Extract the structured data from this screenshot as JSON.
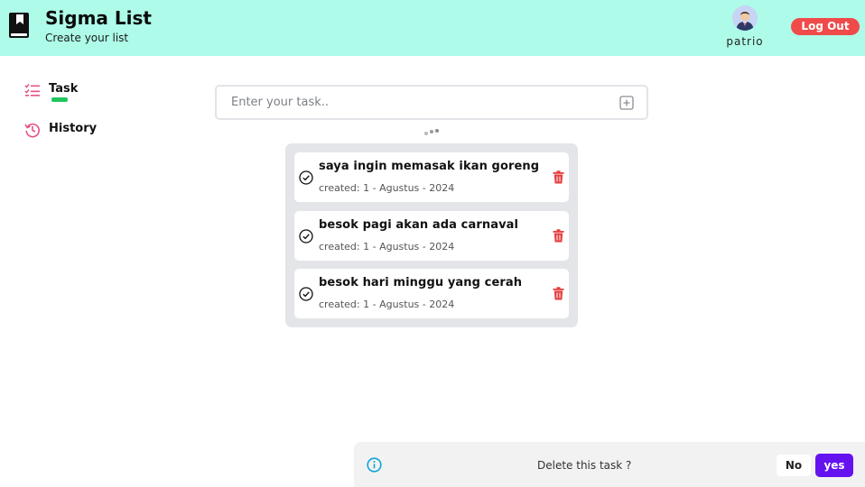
{
  "header": {
    "title": "Sigma List",
    "subtitle": "Create your list",
    "username": "patrio",
    "logout_label": "Log Out",
    "logo_icon": "book-bookmark-icon",
    "avatar_icon": "user-avatar"
  },
  "sidebar": {
    "items": [
      {
        "label": "Task",
        "icon": "task-list-icon",
        "active": true
      },
      {
        "label": "History",
        "icon": "history-icon",
        "active": false
      }
    ]
  },
  "task_input": {
    "placeholder": "Enter your task..",
    "add_icon": "plus-square-icon"
  },
  "tasks": [
    {
      "title": "saya ingin memasak ikan goreng",
      "created": "created: 1 - Agustus - 2024"
    },
    {
      "title": "besok pagi akan ada carnaval",
      "created": "created: 1 - Agustus - 2024"
    },
    {
      "title": "besok hari minggu yang cerah",
      "created": "created: 1 - Agustus - 2024"
    }
  ],
  "confirm_dialog": {
    "message": "Delete this task ?",
    "no_label": "No",
    "yes_label": "yes",
    "icon": "info-icon"
  },
  "colors": {
    "header_bg": "#aefbe9",
    "logout": "#f04a4a",
    "accent_pink": "#e8508a",
    "active_indicator": "#22c55e",
    "delete": "#e53e3e",
    "confirm_yes": "#6412f0",
    "info": "#0ea5d8"
  }
}
